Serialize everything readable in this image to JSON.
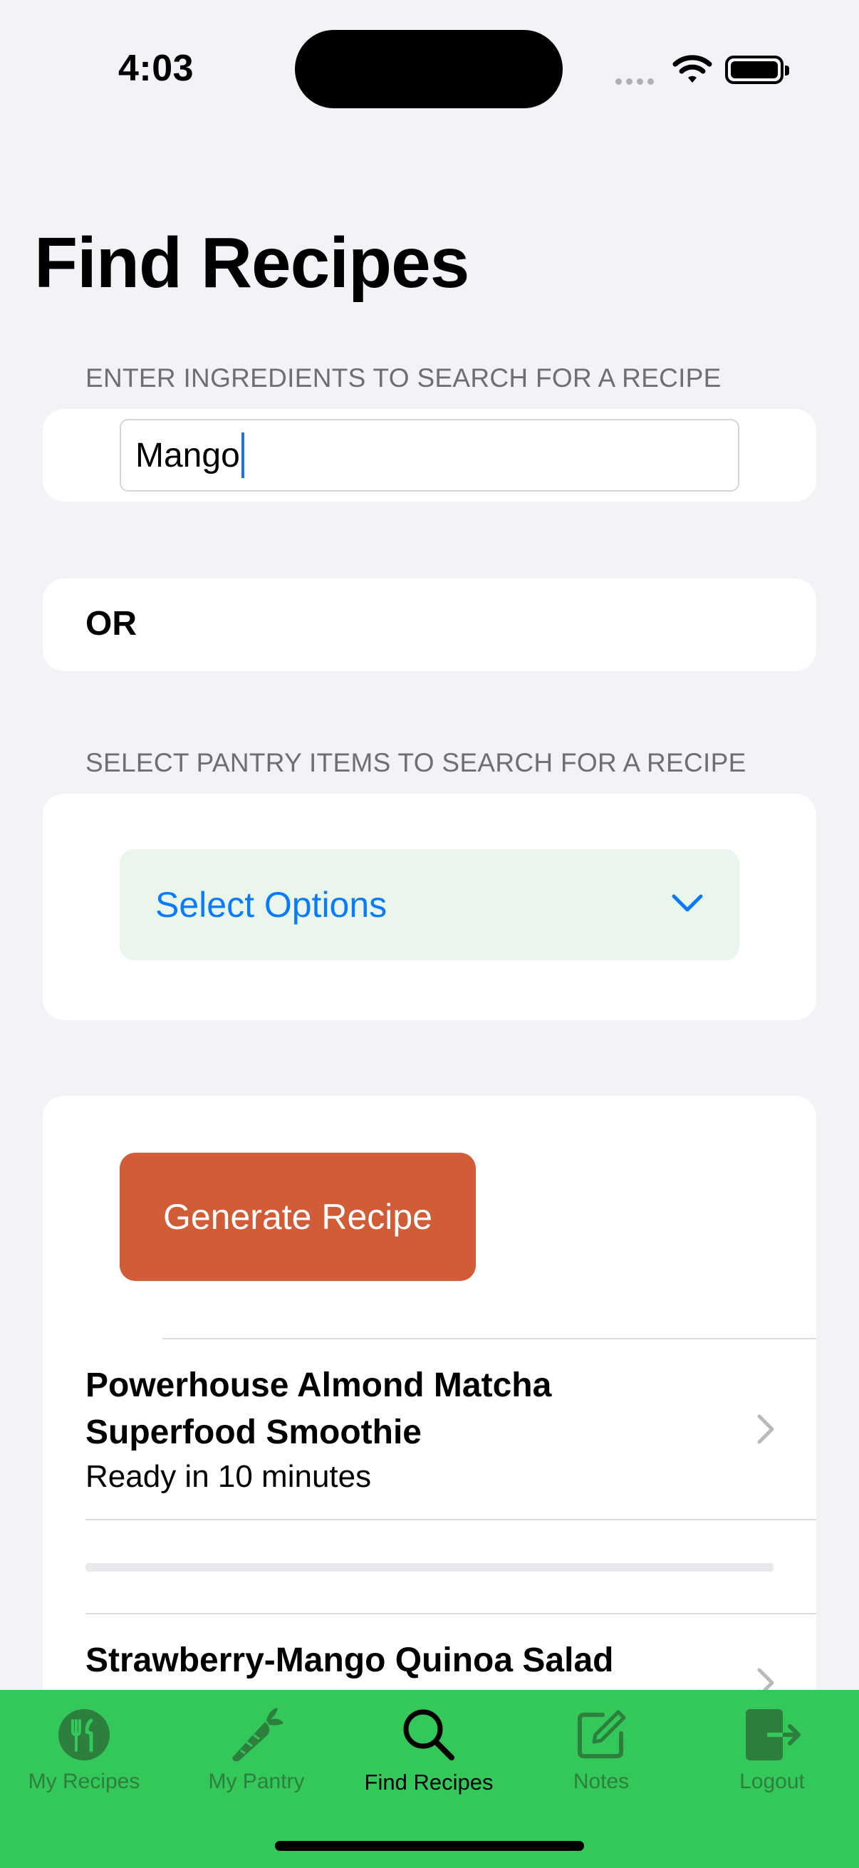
{
  "status_bar": {
    "time": "4:03"
  },
  "page": {
    "title": "Find Recipes"
  },
  "ingredients_section": {
    "header": "ENTER INGREDIENTS TO SEARCH FOR A RECIPE",
    "input_value": "Mango"
  },
  "or_section": {
    "label": "OR"
  },
  "pantry_section": {
    "header": "SELECT PANTRY ITEMS TO SEARCH FOR A RECIPE",
    "dropdown_label": "Select Options"
  },
  "actions": {
    "generate_label": "Generate Recipe"
  },
  "recipes": [
    {
      "title_line1": "Powerhouse Almond Matcha",
      "title_line2": "Superfood Smoothie",
      "subtitle": "Ready in 10 minutes"
    },
    {
      "title_line1": "Strawberry-Mango Quinoa Salad"
    }
  ],
  "tab_bar": {
    "tabs": [
      {
        "label": "My Recipes",
        "icon": "fork-knife-icon"
      },
      {
        "label": "My Pantry",
        "icon": "carrot-icon"
      },
      {
        "label": "Find Recipes",
        "icon": "magnifier-icon"
      },
      {
        "label": "Notes",
        "icon": "square-pencil-icon"
      },
      {
        "label": "Logout",
        "icon": "door-arrow-icon"
      }
    ],
    "active_index": 2
  },
  "colors": {
    "accent_button": "#D05C38",
    "tab_bar": "#34C759",
    "link_blue": "#0A7AFF",
    "dropdown_bg": "#EAF6EC"
  }
}
